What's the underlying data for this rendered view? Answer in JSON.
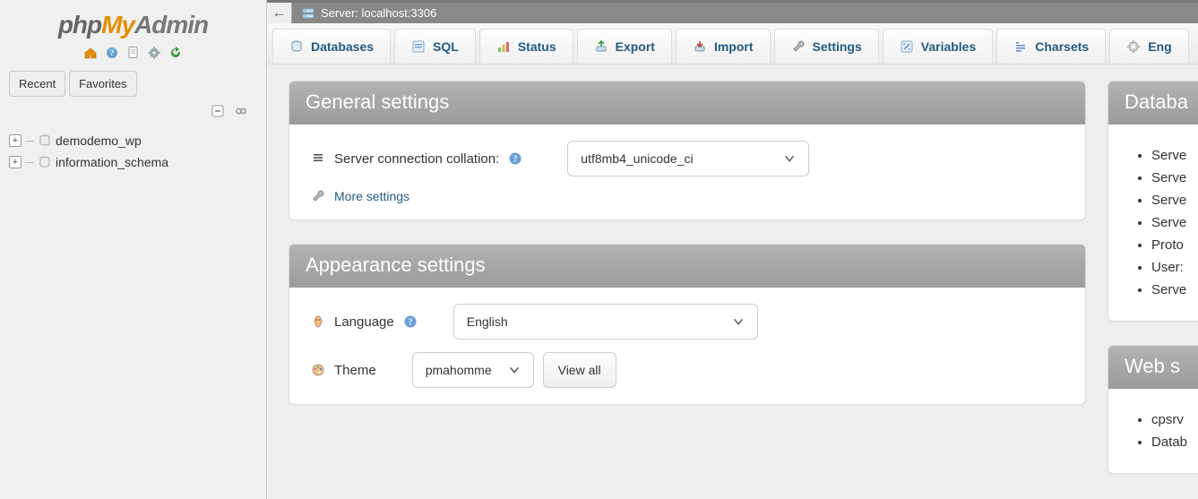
{
  "logo": {
    "p1": "php",
    "p2": "My",
    "p3": "Admin"
  },
  "nav_tabs": {
    "recent": "Recent",
    "favorites": "Favorites"
  },
  "databases": [
    "demodemo_wp",
    "information_schema"
  ],
  "breadcrumb": {
    "label": "Server: localhost:3306"
  },
  "tabs": [
    {
      "id": "databases",
      "label": "Databases",
      "icon": "database-icon"
    },
    {
      "id": "sql",
      "label": "SQL",
      "icon": "sql-icon"
    },
    {
      "id": "status",
      "label": "Status",
      "icon": "status-icon"
    },
    {
      "id": "export",
      "label": "Export",
      "icon": "export-icon"
    },
    {
      "id": "import",
      "label": "Import",
      "icon": "import-icon"
    },
    {
      "id": "settings",
      "label": "Settings",
      "icon": "wrench-icon"
    },
    {
      "id": "variables",
      "label": "Variables",
      "icon": "variables-icon"
    },
    {
      "id": "charsets",
      "label": "Charsets",
      "icon": "charsets-icon"
    },
    {
      "id": "engines",
      "label": "Eng",
      "icon": "engine-icon"
    }
  ],
  "general": {
    "title": "General settings",
    "collation_label": "Server connection collation:",
    "collation_value": "utf8mb4_unicode_ci",
    "more": "More settings"
  },
  "appearance": {
    "title": "Appearance settings",
    "language_label": "Language",
    "language_value": "English",
    "theme_label": "Theme",
    "theme_value": "pmahomme",
    "view_all": "View all"
  },
  "db_server": {
    "title": "Databa",
    "items": [
      "Serve",
      "Serve",
      "Serve",
      "Serve",
      "Proto",
      "User:",
      "Serve"
    ]
  },
  "web_server": {
    "title": "Web s",
    "items": [
      "cpsrv",
      "Datab"
    ]
  }
}
